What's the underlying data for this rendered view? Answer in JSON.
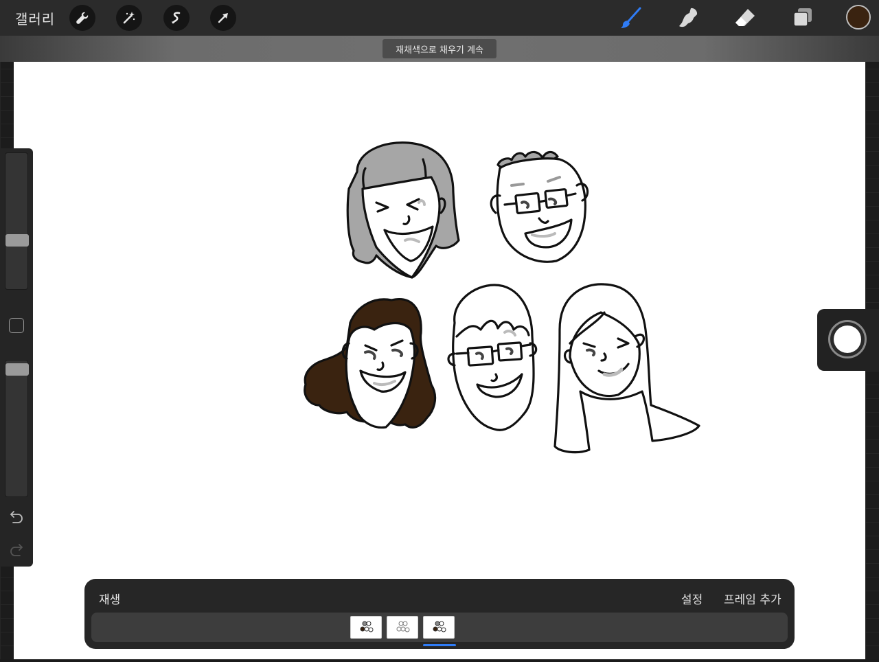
{
  "topbar": {
    "gallery_label": "갤러리",
    "tools_left": [
      "wrench-icon",
      "magic-wand-icon",
      "selection-icon",
      "move-arrow-icon"
    ],
    "tools_right": [
      "brush-icon",
      "smudge-icon",
      "eraser-icon",
      "layers-icon"
    ],
    "active_tool": "brush-icon",
    "current_color": "#3a2310"
  },
  "toast": {
    "message": "재채색으로 채우기 계속"
  },
  "sidebar": {
    "brush_size_level": 0.33,
    "opacity_level": 0.95,
    "undo_icon": "undo-icon",
    "redo_icon": "redo-icon"
  },
  "record": {
    "icon": "record-button"
  },
  "animation": {
    "play_label": "재생",
    "settings_label": "설정",
    "add_frame_label": "프레임 추가",
    "frames": [
      "frame-1",
      "frame-2",
      "frame-3"
    ],
    "selected_frame": 3
  },
  "colors": {
    "accent": "#2f7cf6",
    "brown_hair": "#3a2310",
    "gray_hair": "#a6a6a6"
  }
}
